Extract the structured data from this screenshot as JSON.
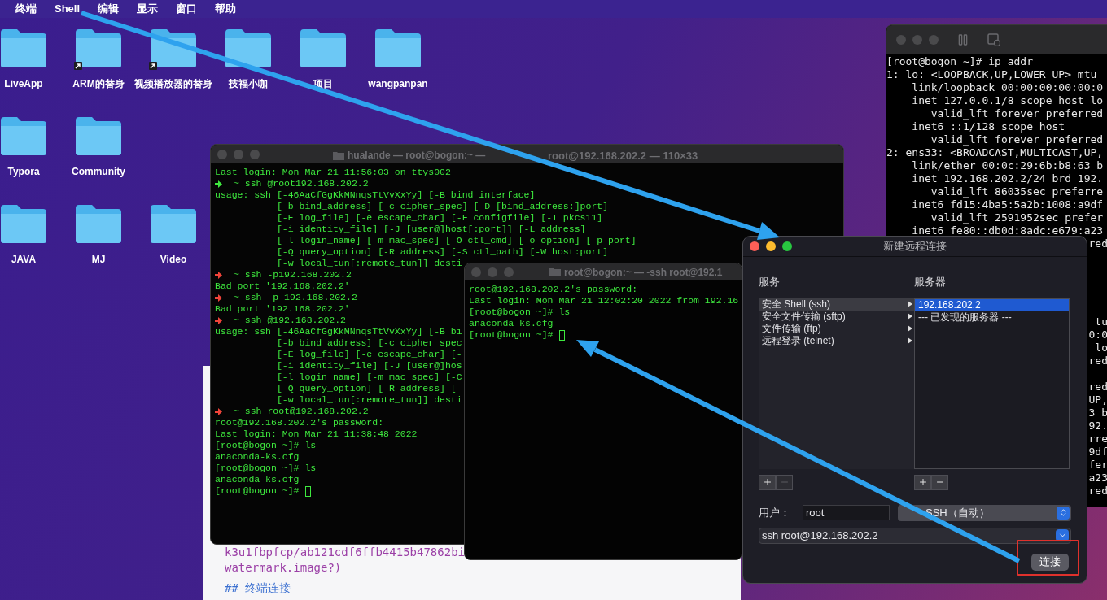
{
  "menu_bar": {
    "items": [
      "终端",
      "Shell",
      "编辑",
      "显示",
      "窗口",
      "帮助"
    ]
  },
  "desktop": {
    "rows": [
      {
        "icons": [
          {
            "label": "LiveApp",
            "alias": false
          },
          {
            "label": "ARM的替身",
            "alias": true
          },
          {
            "label": "视频播放器的替身",
            "alias": true
          },
          {
            "label": "技福小咖",
            "alias": false
          },
          {
            "label": "项目",
            "alias": false
          },
          {
            "label": "wangpanpan",
            "alias": false
          }
        ]
      },
      {
        "icons": [
          {
            "label": "Typora",
            "alias": false
          },
          {
            "label": "Community",
            "alias": false
          }
        ]
      },
      {
        "icons": [
          {
            "label": "JAVA",
            "alias": false
          },
          {
            "label": "MJ",
            "alias": false
          },
          {
            "label": "Video",
            "alias": false
          }
        ]
      }
    ]
  },
  "document": {
    "lines": [
      "k3u1fbpfcp/ab121cdf6ffb4415b47862bi",
      "watermark.image?)",
      "## 终端连接"
    ]
  },
  "main_terminal": {
    "title_parts": [
      "hualande — root@bogon:~ —",
      "root@192.168.202.2 — 110×33"
    ],
    "focused": false,
    "lines": [
      {
        "kind": "text",
        "text": "Last login: Mon Mar 21 11:56:03 on ttys002"
      },
      {
        "kind": "prompt",
        "color": "#3ee83e",
        "text": "~ ssh @root192.168.202.2"
      },
      {
        "kind": "text",
        "text": "usage: ssh [-46AaCfGgKkMNnqsTtVvXxYy] [-B bind_interface]"
      },
      {
        "kind": "text",
        "text": "           [-b bind_address] [-c cipher_spec] [-D [bind_address:]port]"
      },
      {
        "kind": "text",
        "text": "           [-E log_file] [-e escape_char] [-F configfile] [-I pkcs11]"
      },
      {
        "kind": "text",
        "text": "           [-i identity_file] [-J [user@]host[:port]] [-L address]"
      },
      {
        "kind": "text",
        "text": "           [-l login_name] [-m mac_spec] [-O ctl_cmd] [-o option] [-p port]"
      },
      {
        "kind": "text",
        "text": "           [-Q query_option] [-R address] [-S ctl_path] [-W host:port]"
      },
      {
        "kind": "text",
        "text": "           [-w local_tun[:remote_tun]] desti"
      },
      {
        "kind": "prompt",
        "color": "#f0443a",
        "text": "~ ssh -p192.168.202.2"
      },
      {
        "kind": "text",
        "text": "Bad port '192.168.202.2'"
      },
      {
        "kind": "prompt",
        "color": "#f0443a",
        "text": "~ ssh -p 192.168.202.2"
      },
      {
        "kind": "text",
        "text": "Bad port '192.168.202.2'"
      },
      {
        "kind": "prompt",
        "color": "#f0443a",
        "text": "~ ssh @192.168.202.2"
      },
      {
        "kind": "text",
        "text": "usage: ssh [-46AaCfGgKkMNnqsTtVvXxYy] [-B bi"
      },
      {
        "kind": "text",
        "text": "           [-b bind_address] [-c cipher_spec"
      },
      {
        "kind": "text",
        "text": "           [-E log_file] [-e escape_char] [-"
      },
      {
        "kind": "text",
        "text": "           [-i identity_file] [-J [user@]hos"
      },
      {
        "kind": "text",
        "text": "           [-l login_name] [-m mac_spec] [-C"
      },
      {
        "kind": "text",
        "text": "           [-Q query_option] [-R address] [-"
      },
      {
        "kind": "text",
        "text": "           [-w local_tun[:remote_tun]] desti"
      },
      {
        "kind": "prompt",
        "color": "#f0443a",
        "text": "~ ssh root@192.168.202.2"
      },
      {
        "kind": "text",
        "text": "root@192.168.202.2's password:"
      },
      {
        "kind": "text",
        "text": "Last login: Mon Mar 21 11:38:48 2022"
      },
      {
        "kind": "shell",
        "text": "[root@bogon ~]# ls",
        "cursor": false
      },
      {
        "kind": "text",
        "text": "anaconda-ks.cfg"
      },
      {
        "kind": "shell",
        "text": "[root@bogon ~]# ls",
        "cursor": false
      },
      {
        "kind": "text",
        "text": "anaconda-ks.cfg"
      },
      {
        "kind": "shell",
        "text": "[root@bogon ~]#",
        "cursor": true
      }
    ]
  },
  "ssh_terminal": {
    "title": "root@bogon:~ — -ssh root@192.1",
    "focused": false,
    "lines": [
      {
        "kind": "text",
        "text": "root@192.168.202.2's password:"
      },
      {
        "kind": "text",
        "text": "Last login: Mon Mar 21 12:02:20 2022 from 192.16"
      },
      {
        "kind": "shell",
        "text": "[root@bogon ~]# ls",
        "cursor": false
      },
      {
        "kind": "text",
        "text": "anaconda-ks.cfg"
      },
      {
        "kind": "shell",
        "text": "[root@bogon ~]#",
        "cursor": true
      }
    ]
  },
  "vm_console": {
    "focused": false,
    "lines": [
      {
        "kind": "full",
        "text": "[root@bogon ~]# ip addr"
      },
      {
        "kind": "full",
        "text": "1: lo: <LOOPBACK,UP,LOWER_UP> mtu"
      },
      {
        "kind": "full",
        "text": "    link/loopback 00:00:00:00:00:0"
      },
      {
        "kind": "full",
        "text": "    inet 127.0.0.1/8 scope host lo"
      },
      {
        "kind": "full",
        "text": "       valid_lft forever preferred"
      },
      {
        "kind": "full",
        "text": "    inet6 ::1/128 scope host"
      },
      {
        "kind": "full",
        "text": "       valid_lft forever preferred"
      },
      {
        "kind": "full",
        "text": "2: ens33: <BROADCAST,MULTICAST,UP,"
      },
      {
        "kind": "full",
        "text": "    link/ether 00:0c:29:6b:b8:63 b"
      },
      {
        "kind": "full",
        "text": "    inet 192.168.202.2/24 brd 192."
      },
      {
        "kind": "full",
        "text": "       valid_lft 86035sec preferre"
      },
      {
        "kind": "full",
        "text": "    inet6 fd15:4ba5:5a2b:1008:a9df"
      },
      {
        "kind": "full",
        "text": "       valid_lft 2591952sec prefer"
      },
      {
        "kind": "full",
        "text": "    inet6 fe80::db0d:8adc:e679:a23"
      },
      {
        "kind": "tail",
        "text": "red"
      },
      {
        "kind": "blank"
      },
      {
        "kind": "blank"
      },
      {
        "kind": "blank"
      },
      {
        "kind": "blank"
      },
      {
        "kind": "blank"
      },
      {
        "kind": "tail",
        "text": "tu"
      },
      {
        "kind": "tail",
        "text": "0:0"
      },
      {
        "kind": "tail",
        "text": "lo"
      },
      {
        "kind": "tail",
        "text": "red"
      },
      {
        "kind": "blank"
      },
      {
        "kind": "tail",
        "text": "red"
      },
      {
        "kind": "tail",
        "text": "UP,"
      },
      {
        "kind": "tail",
        "text": "3 b"
      },
      {
        "kind": "tail",
        "text": "92."
      },
      {
        "kind": "tail",
        "text": "rre"
      },
      {
        "kind": "tail",
        "text": "9df"
      },
      {
        "kind": "tail",
        "text": "fer"
      },
      {
        "kind": "tail",
        "text": "a23"
      },
      {
        "kind": "tail",
        "text": "red"
      }
    ]
  },
  "dialog": {
    "title": "新建远程连接",
    "focused": true,
    "services": {
      "heading": "服务",
      "remove_disabled": true,
      "items": [
        {
          "label": "安全 Shell (ssh)",
          "selected": true
        },
        {
          "label": "安全文件传输 (sftp)",
          "selected": false
        },
        {
          "label": "文件传输 (ftp)",
          "selected": false
        },
        {
          "label": "远程登录 (telnet)",
          "selected": false
        }
      ]
    },
    "servers": {
      "heading": "服务器",
      "remove_disabled": false,
      "items": [
        {
          "label": "192.168.202.2",
          "selected": true
        },
        {
          "label": "--- 已发现的服务器 ---",
          "selected": false
        }
      ]
    },
    "user_label": "用户：",
    "user": "root",
    "protocol": "SSH（自动）",
    "command": "ssh root@192.168.202.2",
    "connect": "连接"
  }
}
